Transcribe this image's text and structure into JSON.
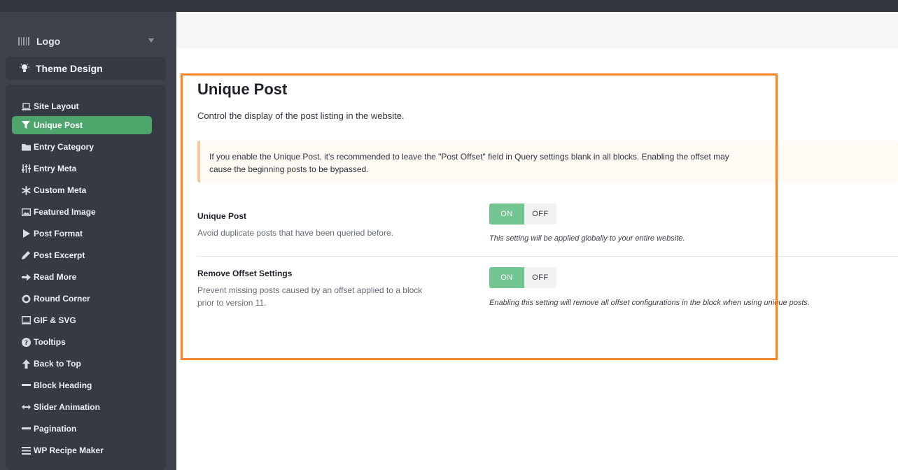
{
  "sidebar": {
    "logo_label": "Logo",
    "section_label": "Theme Design",
    "items": [
      {
        "label": "Site Layout",
        "icon": "laptop-icon"
      },
      {
        "label": "Unique Post",
        "icon": "filter-icon",
        "active": true
      },
      {
        "label": "Entry Category",
        "icon": "folder-icon"
      },
      {
        "label": "Entry Meta",
        "icon": "sliders-icon"
      },
      {
        "label": "Custom Meta",
        "icon": "asterisk-icon"
      },
      {
        "label": "Featured Image",
        "icon": "image-icon"
      },
      {
        "label": "Post Format",
        "icon": "play-icon"
      },
      {
        "label": "Post Excerpt",
        "icon": "pencil-icon"
      },
      {
        "label": "Read More",
        "icon": "arrow-right-icon"
      },
      {
        "label": "Round Corner",
        "icon": "circle-icon"
      },
      {
        "label": "GIF & SVG",
        "icon": "monitor-icon"
      },
      {
        "label": "Tooltips",
        "icon": "question-icon"
      },
      {
        "label": "Back to Top",
        "icon": "arrow-up-icon"
      },
      {
        "label": "Block Heading",
        "icon": "minus-icon"
      },
      {
        "label": "Slider Animation",
        "icon": "arrows-horizontal-icon"
      },
      {
        "label": "Pagination",
        "icon": "minus-icon"
      },
      {
        "label": "WP Recipe Maker",
        "icon": "list-icon"
      }
    ]
  },
  "main": {
    "title": "Unique Post",
    "subtitle": "Control the display of the post listing in the website.",
    "notice": "If you enable the Unique Post, it's recommended to leave the \"Post Offset\" field in Query settings blank in all blocks. Enabling the offset may cause the beginning posts to be bypassed.",
    "settings": [
      {
        "title": "Unique Post",
        "description": "Avoid duplicate posts that have been queried before.",
        "on_label": "ON",
        "off_label": "OFF",
        "value": "ON",
        "note": "This setting will be applied globally to your entire website."
      },
      {
        "title": "Remove Offset Settings",
        "description": "Prevent missing posts caused by an offset applied to a block prior to version 11.",
        "on_label": "ON",
        "off_label": "OFF",
        "value": "ON",
        "note": "Enabling this setting will remove all offset configurations in the block when using unique posts."
      }
    ]
  },
  "colors": {
    "sidebar_bg": "#3d424d",
    "active_item": "#4ea56b",
    "toggle_on": "#73c691",
    "highlight_border": "#f5862f",
    "notice_border": "#f7c794"
  }
}
